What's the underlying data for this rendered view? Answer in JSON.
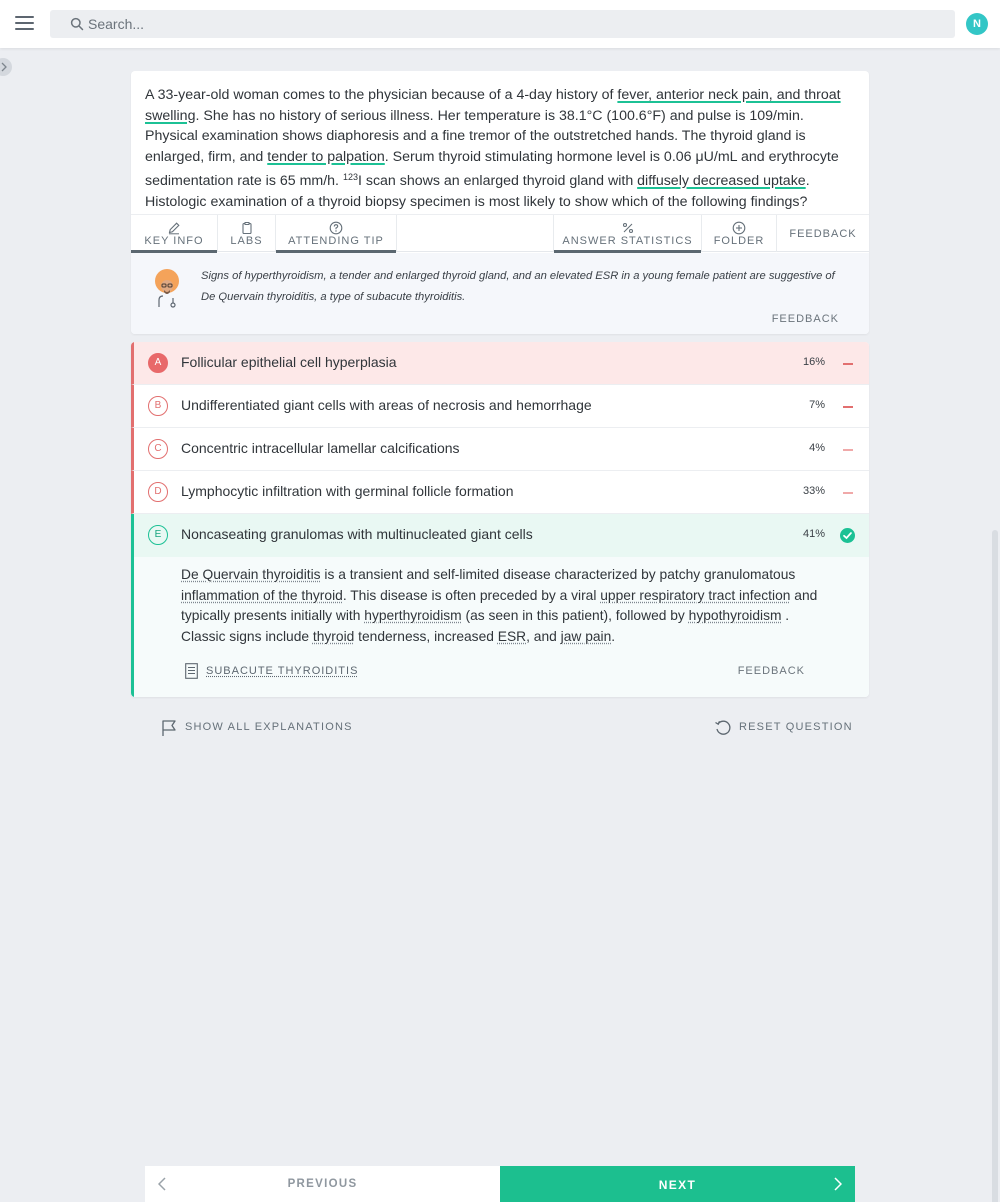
{
  "header": {
    "search_placeholder": "Search...",
    "avatar_initial": "N",
    "menu_icon": "hamburger-menu-icon",
    "search_icon": "search-icon"
  },
  "question": {
    "p1": "A 33-year-old woman comes to the physician because of a 4-day history of ",
    "h1": "fever, anterior neck pain, and throat swelling",
    "p2": ". She has no history of serious illness. Her temperature is 38.1°C (100.6°F) and pulse is 109/min. Physical examination shows diaphoresis and a fine tremor of the outstretched hands. The thyroid gland is enlarged, firm, and ",
    "h2": "tender to palpation",
    "p3": ". Serum thyroid stimulating hormone level is 0.06 μU/mL and erythrocyte sedimentation rate is 65 mm/h. ",
    "sup": "123",
    "p4": "I scan shows an enlarged thyroid gland with ",
    "h3": "diffusely decreased uptake",
    "p5": ". Histologic examination of a thyroid biopsy specimen is most likely to show which of the following findings?"
  },
  "tabs": {
    "key_info": "KEY INFO",
    "labs": "LABS",
    "attending_tip": "ATTENDING TIP",
    "answer_statistics": "ANSWER STATISTICS",
    "folder": "FOLDER",
    "feedback": "FEEDBACK"
  },
  "tip": {
    "text": "Signs of hyperthyroidism, a tender and enlarged thyroid gland, and an elevated ESR in a young female patient are suggestive of De Quervain thyroiditis, a type of subacute thyroiditis.",
    "feedback": "FEEDBACK"
  },
  "answers": [
    {
      "letter": "A",
      "text": "Follicular epithelial cell hyperplasia",
      "pct": "16%",
      "state": "selected-wrong"
    },
    {
      "letter": "B",
      "text": "Undifferentiated giant cells with areas of necrosis and hemorrhage",
      "pct": "7%",
      "state": "wrong"
    },
    {
      "letter": "C",
      "text": "Concentric intracellular lamellar calcifications",
      "pct": "4%",
      "state": "wrong"
    },
    {
      "letter": "D",
      "text": "Lymphocytic infiltration with germinal follicle formation",
      "pct": "33%",
      "state": "wrong"
    },
    {
      "letter": "E",
      "text": "Noncaseating granulomas with multinucleated giant cells",
      "pct": "41%",
      "state": "correct"
    }
  ],
  "explanation": {
    "d1": "De Quervain thyroiditis",
    "t1": " is a transient and self-limited disease characterized by patchy granulomatous ",
    "d2": "inflammation of the thyroid",
    "t2": ". This disease is often preceded by a viral ",
    "d3": "upper respiratory tract infection",
    "t3": " and typically presents initially with ",
    "d4": "hyperthyroidism",
    "t4": " (as seen in this patient), followed by ",
    "d5": "hypothyroidism",
    "t5": " . Classic signs include ",
    "d6": "thyroid",
    "t6": " tenderness, increased ",
    "d7": "ESR",
    "t7": ", and ",
    "d8": "jaw pain",
    "t8": ".",
    "reference": "SUBACUTE THYROIDITIS",
    "feedback": "FEEDBACK"
  },
  "actions": {
    "show_all": "SHOW ALL EXPLANATIONS",
    "reset": "RESET QUESTION"
  },
  "nav": {
    "previous": "PREVIOUS",
    "next": "NEXT"
  },
  "colors": {
    "accent": "#1cc195",
    "wrong": "#e26f6f",
    "avatar": "#33c6c6"
  }
}
